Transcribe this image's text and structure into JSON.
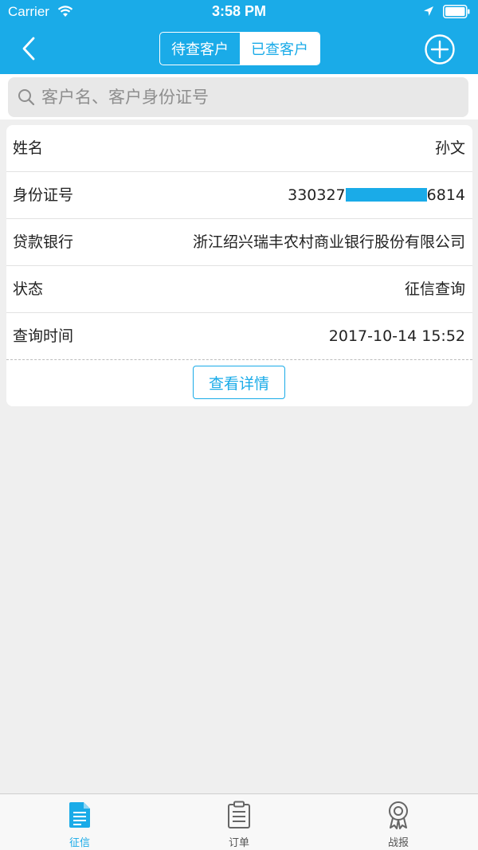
{
  "status_bar": {
    "carrier": "Carrier",
    "time": "3:58 PM"
  },
  "nav": {
    "segments": [
      {
        "label": "待查客户",
        "active": false
      },
      {
        "label": "已查客户",
        "active": true
      }
    ]
  },
  "search": {
    "placeholder": "客户名、客户身份证号",
    "value": ""
  },
  "card": {
    "name_label": "姓名",
    "name_value": "孙文",
    "id_label": "身份证号",
    "id_prefix": "330327",
    "id_suffix": "6814",
    "bank_label": "贷款银行",
    "bank_value": "浙江绍兴瑞丰农村商业银行股份有限公司",
    "status_label": "状态",
    "status_value": "征信查询",
    "time_label": "查询时间",
    "time_value": "2017-10-14 15:52",
    "detail_button": "查看详情"
  },
  "tabs": [
    {
      "label": "征信",
      "icon": "document-icon",
      "active": true
    },
    {
      "label": "订单",
      "icon": "clipboard-icon",
      "active": false
    },
    {
      "label": "战报",
      "icon": "award-icon",
      "active": false
    }
  ],
  "colors": {
    "accent": "#1aabe8",
    "background": "#efefef"
  }
}
